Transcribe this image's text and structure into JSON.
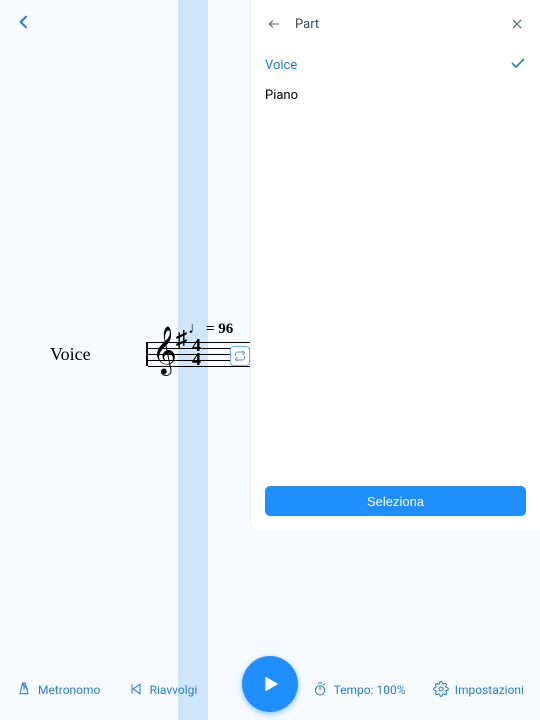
{
  "colors": {
    "accent": "#1f8fff",
    "link": "#1f7ae0"
  },
  "staff": {
    "part_label": "Voice",
    "tempo_mark": "= 96",
    "time_sig_top": "4",
    "time_sig_bottom": "4"
  },
  "panel": {
    "title": "Part",
    "items": [
      {
        "label": "Voice",
        "selected": true
      },
      {
        "label": "Piano",
        "selected": false
      }
    ],
    "select_button": "Seleziona"
  },
  "bottom": {
    "metronome": "Metronomo",
    "rewind": "Riavvolgi",
    "tempo": "Tempo: 100%",
    "settings": "Impostazioni"
  }
}
